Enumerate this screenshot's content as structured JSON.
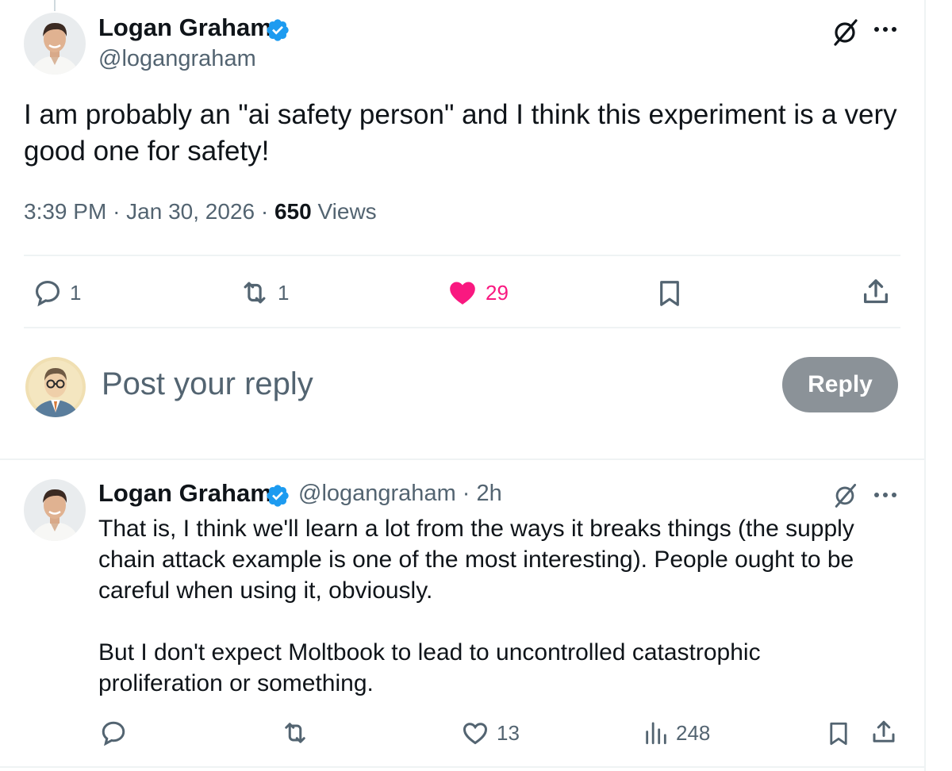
{
  "main_post": {
    "author_name": "Logan Graham",
    "handle": "@logangraham",
    "text_line1": "I am probably an \"ai safety person\" and I think this experiment is a very",
    "text_line2": "good one for safety!",
    "time": "3:39 PM",
    "date": "Jan 30, 2026",
    "views_count": "650",
    "views_label": "Views",
    "separator": "·",
    "actions": {
      "replies": "1",
      "reposts": "1",
      "likes": "29"
    }
  },
  "composer": {
    "placeholder": "Post your reply",
    "reply_button": "Reply"
  },
  "reply_post": {
    "author_name": "Logan Graham",
    "handle_time": "@logangraham · 2h",
    "para1_line1": "That is, I think we'll learn a lot from the ways it breaks things (the supply",
    "para1_line2": "chain attack example is one of the most interesting). People ought to be",
    "para1_line3": "careful when using it, obviously.",
    "para2_line1": "But I don't expect Moltbook to lead to uncontrolled catastrophic",
    "para2_line2": "proliferation or something.",
    "actions": {
      "likes": "13",
      "views": "248"
    }
  },
  "colors": {
    "accent_blue": "#1d9bf0",
    "like_pink": "#f91880",
    "secondary_text": "#536471",
    "reply_button_bg": "#8b9298"
  }
}
